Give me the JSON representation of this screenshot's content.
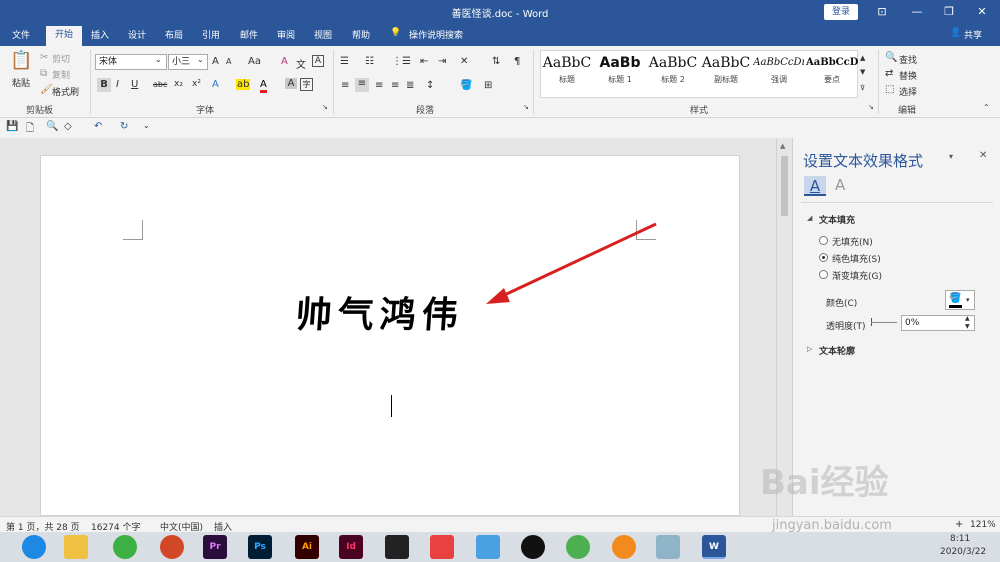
{
  "window": {
    "title": "善医怪谈.doc - Word",
    "signin_label": "登录",
    "share_label": "共享",
    "controls": [
      "⊡",
      "—",
      "❐",
      "✕"
    ]
  },
  "tabs": [
    "文件",
    "开始",
    "插入",
    "设计",
    "布局",
    "引用",
    "邮件",
    "审阅",
    "视图",
    "帮助"
  ],
  "tell_me": "操作说明搜索",
  "clipboard": {
    "paste": "粘贴",
    "cut": "剪切",
    "copy": "复制",
    "format_painter": "格式刷",
    "label": "剪贴板"
  },
  "font": {
    "name": "宋体",
    "size": "小三",
    "label": "字体",
    "buttons": [
      "A",
      "A",
      "Aa",
      "A",
      "文",
      "A",
      "B",
      "I",
      "U",
      "abc",
      "x₂",
      "x²",
      "A",
      "ab",
      "A",
      "A",
      "字"
    ]
  },
  "paragraph": {
    "label": "段落"
  },
  "styles": {
    "label": "样式",
    "items": [
      {
        "sample": "AaBbC",
        "name": "标题"
      },
      {
        "sample": "AaBb",
        "name": "标题 1"
      },
      {
        "sample": "AaBbC",
        "name": "标题 2"
      },
      {
        "sample": "AaBbC",
        "name": "副标题"
      },
      {
        "sample": "AaBbCcDı",
        "name": "强调"
      },
      {
        "sample": "AaBbCcD",
        "name": "要点"
      }
    ]
  },
  "editing": {
    "find": "查找",
    "replace": "替换",
    "select": "选择",
    "label": "编辑"
  },
  "document": {
    "wordart_text": "帅气鸿伟"
  },
  "pane": {
    "title": "设置文本效果格式",
    "section_fill": "文本填充",
    "no_fill": "无填充(N)",
    "solid_fill": "纯色填充(S)",
    "gradient_fill": "渐变填充(G)",
    "color_label": "颜色(C)",
    "transparency_label": "透明度(T)",
    "transparency_value": "0%",
    "section_outline": "文本轮廓"
  },
  "status": {
    "page": "第 1 页，共 28 页",
    "words": "16274 个字",
    "language": "中文(中国)",
    "mode": "插入",
    "zoom": "121%"
  },
  "taskbar": {
    "apps": [
      "Pr",
      "Ps",
      "Ai",
      "Id",
      "W"
    ],
    "time": "8:11",
    "date": "2020/3/22"
  },
  "watermark": {
    "brand": "Bai经验",
    "url": "jingyan.baidu.com"
  },
  "colors": {
    "accent": "#2b579a",
    "arrow": "#d82020"
  }
}
